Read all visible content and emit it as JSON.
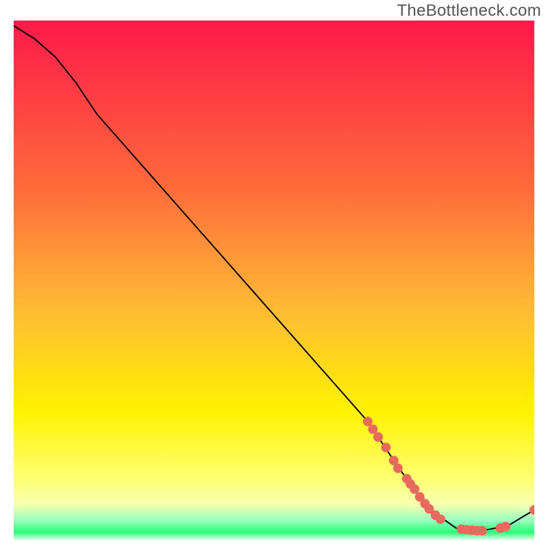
{
  "watermark": "TheBottleneck.com",
  "colors": {
    "gradient_top": "#ff1a4b",
    "gradient_mid1": "#ff8a3a",
    "gradient_mid2": "#fff200",
    "gradient_bottom_yellow": "#ffff6a",
    "gradient_green": "#2dff7a",
    "curve": "#000000",
    "marker_fill": "#e86a5e",
    "marker_stroke": "#d65a50"
  },
  "chart_data": {
    "type": "line",
    "title": "",
    "xlabel": "",
    "ylabel": "",
    "xlim": [
      0,
      100
    ],
    "ylim": [
      0,
      100
    ],
    "curve": [
      {
        "x": 0,
        "y": 99
      },
      {
        "x": 4,
        "y": 96.5
      },
      {
        "x": 8,
        "y": 93
      },
      {
        "x": 12,
        "y": 88
      },
      {
        "x": 16,
        "y": 82
      },
      {
        "x": 68,
        "y": 23
      },
      {
        "x": 74,
        "y": 14
      },
      {
        "x": 80,
        "y": 6
      },
      {
        "x": 85,
        "y": 2.5
      },
      {
        "x": 90,
        "y": 2
      },
      {
        "x": 95,
        "y": 3
      },
      {
        "x": 100,
        "y": 6
      }
    ],
    "markers": [
      {
        "x": 68,
        "y": 23
      },
      {
        "x": 69,
        "y": 21.5
      },
      {
        "x": 70,
        "y": 20
      },
      {
        "x": 71.5,
        "y": 18
      },
      {
        "x": 73,
        "y": 15.5
      },
      {
        "x": 73.8,
        "y": 14
      },
      {
        "x": 75.5,
        "y": 12
      },
      {
        "x": 76.2,
        "y": 11
      },
      {
        "x": 77,
        "y": 10
      },
      {
        "x": 78,
        "y": 8.5
      },
      {
        "x": 79,
        "y": 7.2
      },
      {
        "x": 79.8,
        "y": 6.2
      },
      {
        "x": 81,
        "y": 5
      },
      {
        "x": 82,
        "y": 4.2
      },
      {
        "x": 86,
        "y": 2.3
      },
      {
        "x": 87,
        "y": 2.2
      },
      {
        "x": 88,
        "y": 2.1
      },
      {
        "x": 89,
        "y": 2
      },
      {
        "x": 90,
        "y": 2
      },
      {
        "x": 93.5,
        "y": 2.5
      },
      {
        "x": 94.5,
        "y": 2.8
      },
      {
        "x": 100,
        "y": 6
      }
    ]
  }
}
